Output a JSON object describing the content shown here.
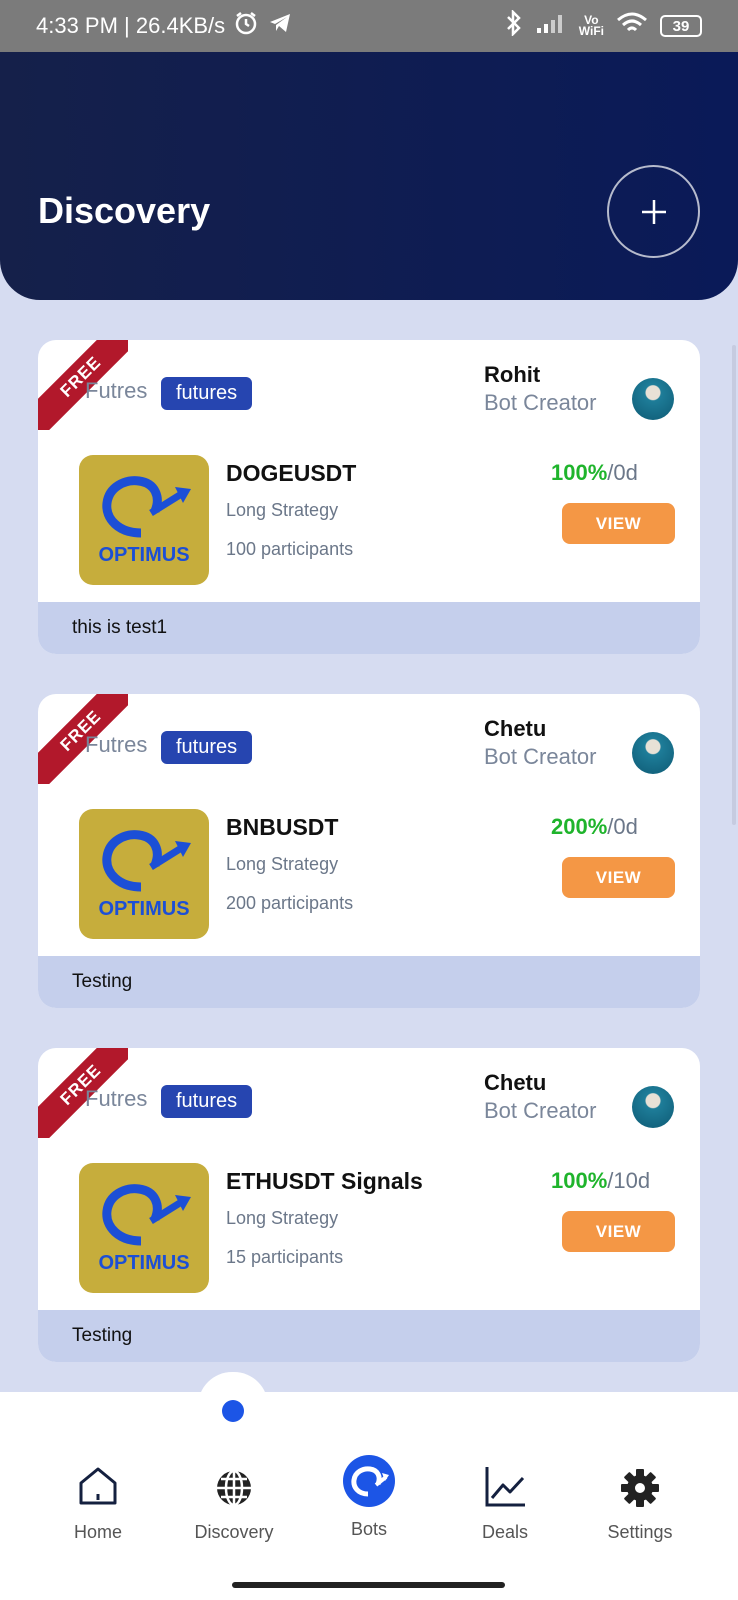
{
  "status_bar": {
    "time_speed": "4:33 PM | 26.4KB/s",
    "vowifi_top": "Vo",
    "vowifi_bottom": "WiFi",
    "battery": "39"
  },
  "header": {
    "title": "Discovery"
  },
  "cards": [
    {
      "ribbon": "FREE",
      "category": "Futres",
      "tag": "futures",
      "creator_name": "Rohit",
      "creator_role": "Bot Creator",
      "logo_text": "OPTIMUS",
      "title": "DOGEUSDT",
      "strategy": "Long Strategy",
      "participants": "100 participants",
      "return_pct": "100%",
      "return_period": "/0d",
      "view_label": "VIEW",
      "description": "this is test1"
    },
    {
      "ribbon": "FREE",
      "category": "Futres",
      "tag": "futures",
      "creator_name": "Chetu",
      "creator_role": "Bot Creator",
      "logo_text": "OPTIMUS",
      "title": "BNBUSDT",
      "strategy": "Long Strategy",
      "participants": "200 participants",
      "return_pct": "200%",
      "return_period": "/0d",
      "view_label": "VIEW",
      "description": "Testing"
    },
    {
      "ribbon": "FREE",
      "category": "Futres",
      "tag": "futures",
      "creator_name": "Chetu",
      "creator_role": "Bot Creator",
      "logo_text": "OPTIMUS",
      "title": "ETHUSDT Signals",
      "strategy": "Long Strategy",
      "participants": "15 participants",
      "return_pct": "100%",
      "return_period": "/10d",
      "view_label": "VIEW",
      "description": "Testing"
    }
  ],
  "nav": {
    "items": [
      {
        "label": "Home",
        "icon": "home-icon"
      },
      {
        "label": "Discovery",
        "icon": "globe-icon"
      },
      {
        "label": "Bots",
        "icon": "bot-logo-icon"
      },
      {
        "label": "Deals",
        "icon": "chart-icon"
      },
      {
        "label": "Settings",
        "icon": "gear-icon"
      }
    ]
  },
  "colors": {
    "header_bg": "#0a1a58",
    "tag_bg": "#2645b0",
    "view_button": "#f49745",
    "positive": "#1fb42c",
    "ribbon": "#b2182b",
    "accent": "#1c55e6"
  }
}
